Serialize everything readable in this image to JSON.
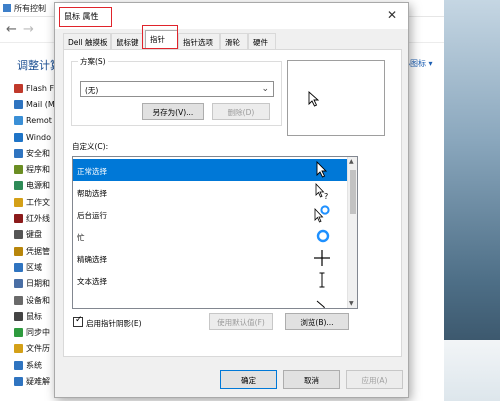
{
  "background": {
    "window_title": "所有控制",
    "heading": "调整计算",
    "view_mode": "小图标 ▾",
    "items": [
      {
        "label": "Flash F",
        "color": "#c0392b"
      },
      {
        "label": "Mail (M",
        "color": "#2f74c0"
      },
      {
        "label": "Remot",
        "color": "#3a8fd6"
      },
      {
        "label": "Windo",
        "color": "#1e74c7"
      },
      {
        "label": "安全和",
        "color": "#2f74c0"
      },
      {
        "label": "程序和",
        "color": "#6b8e23"
      },
      {
        "label": "电源和",
        "color": "#2e8b57"
      },
      {
        "label": "工作文",
        "color": "#d4a017"
      },
      {
        "label": "红外线",
        "color": "#8b1a1a"
      },
      {
        "label": "键盘",
        "color": "#555555"
      },
      {
        "label": "凭据管",
        "color": "#b8860b"
      },
      {
        "label": "区域",
        "color": "#2f74c0"
      },
      {
        "label": "日期和",
        "color": "#4a6fa5"
      },
      {
        "label": "设备和",
        "color": "#6a6a6a"
      },
      {
        "label": "鼠标",
        "color": "#444444"
      },
      {
        "label": "同步中",
        "color": "#2e9b3e"
      },
      {
        "label": "文件历",
        "color": "#d4a017"
      },
      {
        "label": "系统",
        "color": "#2f74c0"
      },
      {
        "label": "疑难解",
        "color": "#2f74c0"
      }
    ]
  },
  "dialog": {
    "title": "鼠标 属性",
    "tabs": [
      "Dell 触摸板",
      "鼠标键",
      "指针",
      "指针选项",
      "滑轮",
      "硬件"
    ],
    "active_tab": "指针",
    "scheme_label": "方案(S)",
    "scheme_value": "(无)",
    "save_as_button": "另存为(V)...",
    "delete_button": "删除(D)",
    "custom_label": "自定义(C):",
    "cursor_list": [
      {
        "label": "正常选择",
        "icon": "arrow-cursor-icon",
        "selected": true
      },
      {
        "label": "帮助选择",
        "icon": "help-cursor-icon",
        "selected": false
      },
      {
        "label": "后台运行",
        "icon": "working-in-background-cursor-icon",
        "selected": false
      },
      {
        "label": "忙",
        "icon": "busy-cursor-icon",
        "selected": false
      },
      {
        "label": "精确选择",
        "icon": "crosshair-cursor-icon",
        "selected": false
      },
      {
        "label": "文本选择",
        "icon": "text-select-cursor-icon",
        "selected": false
      }
    ],
    "shadow_checkbox_label": "启用指针阴影(E)",
    "shadow_checked": true,
    "use_default_button": "使用默认值(F)",
    "browse_button": "浏览(B)...",
    "ok_button": "确定",
    "cancel_button": "取消",
    "apply_button": "应用(A)"
  },
  "colors": {
    "selection": "#0078d7",
    "highlight_annotation": "#e0242b",
    "link_blue": "#1d4f91"
  }
}
